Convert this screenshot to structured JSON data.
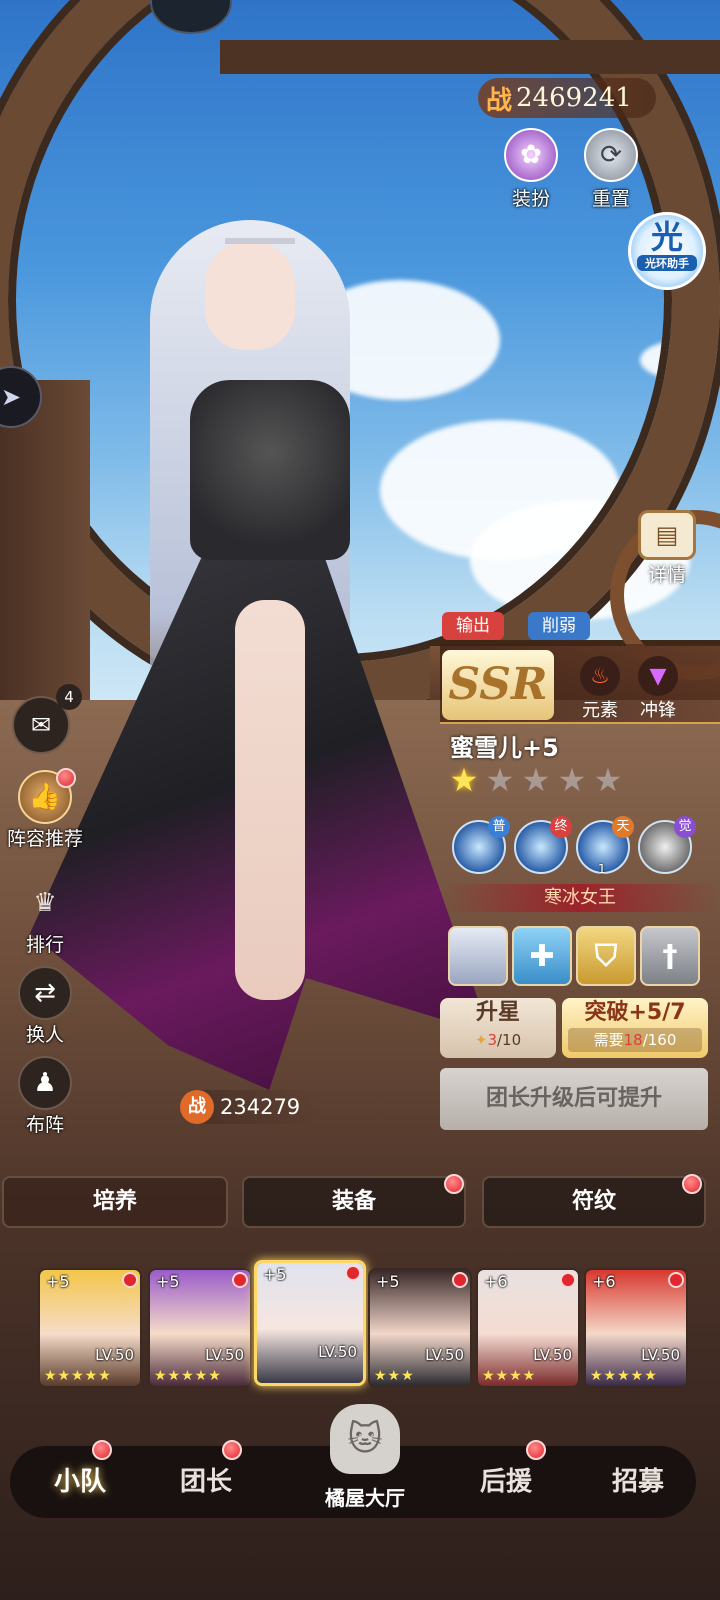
{
  "power_total": {
    "label": "战",
    "value": "2469241"
  },
  "top_buttons": {
    "dress": {
      "label": "装扮",
      "icon": "dress-icon"
    },
    "reset": {
      "label": "重置",
      "icon": "reset-icon"
    }
  },
  "halo_assistant": {
    "glyph": "光",
    "label": "光环助手"
  },
  "detail": {
    "label": "详情",
    "icon": "book-icon"
  },
  "role_tags": [
    "输出",
    "削弱"
  ],
  "rarity": "SSR",
  "attributes": [
    {
      "label": "元素",
      "icon": "flame-icon"
    },
    {
      "label": "冲锋",
      "icon": "charge-icon"
    }
  ],
  "hero": {
    "name": "蜜雪儿+5",
    "stars_total": 5,
    "stars_lit": 1
  },
  "skills": [
    {
      "badge": "普",
      "badge_color": "#3a7fd6"
    },
    {
      "badge": "终",
      "badge_color": "#d8423e"
    },
    {
      "badge": "天",
      "badge_color": "#e07a2a",
      "level": "1"
    },
    {
      "badge": "觉",
      "badge_color": "#8a4fd0"
    }
  ],
  "skill_title": "寒冰女王",
  "upgrade": {
    "star": {
      "title": "升星",
      "current": "3",
      "total": "/10"
    },
    "breakthrough": {
      "title": "突破+5/7",
      "need_label": "需要",
      "current": "18",
      "total": "/160"
    }
  },
  "locked_button": "团长升级后可提升",
  "left_menu": {
    "mail_count": "4",
    "recommend": "阵容推荐",
    "ranking": "排行",
    "swap": "换人",
    "formation": "布阵"
  },
  "power_hero": {
    "label": "战",
    "value": "234279"
  },
  "tabs": [
    "培养",
    "装备",
    "符纹"
  ],
  "roster": [
    {
      "plus": "+5",
      "level": "LV.50",
      "stars": "★★★★★",
      "hair": "#f3c64a"
    },
    {
      "plus": "+5",
      "level": "LV.50",
      "stars": "★★★★★",
      "hair": "#9a5cc9"
    },
    {
      "plus": "+5",
      "level": "LV.50",
      "stars": "",
      "hair": "#dfe3ee"
    },
    {
      "plus": "+5",
      "level": "LV.50",
      "stars": "★★★",
      "hair": "#3a2a2a"
    },
    {
      "plus": "+6",
      "level": "LV.50",
      "stars": "★★★★",
      "hair": "#e8e1e0"
    },
    {
      "plus": "+6",
      "level": "LV.50",
      "stars": "★★★★★",
      "hair": "#d8382e"
    }
  ],
  "nav": {
    "squad": "小队",
    "leader": "团长",
    "hall": "橘屋大厅",
    "support": "后援",
    "recruit": "招募"
  }
}
